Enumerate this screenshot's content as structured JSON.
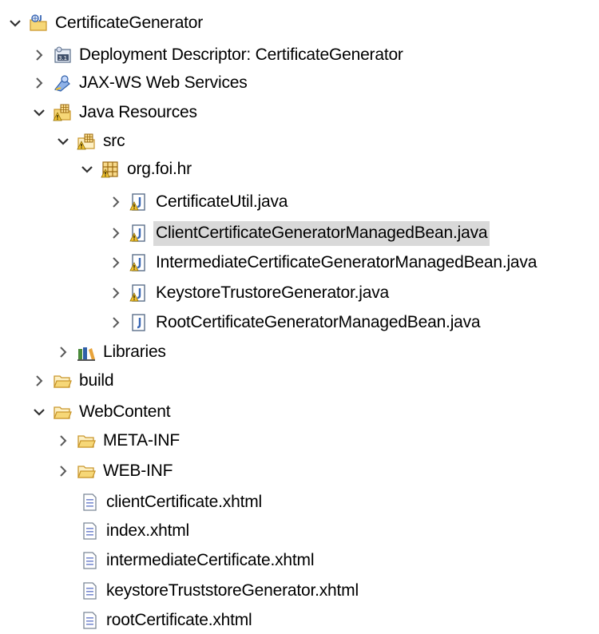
{
  "tree": {
    "project": {
      "label": "CertificateGenerator",
      "icon": "eclipse-web-project-icon"
    },
    "deployment": {
      "label": "Deployment Descriptor: CertificateGenerator",
      "icon": "deployment-descriptor-icon"
    },
    "jaxws": {
      "label": "JAX-WS Web Services",
      "icon": "web-services-icon"
    },
    "java_resources": {
      "label": "Java Resources",
      "icon": "java-resources-icon"
    },
    "src": {
      "label": "src",
      "icon": "source-folder-icon"
    },
    "package": {
      "label": "org.foi.hr",
      "icon": "java-package-icon"
    },
    "java_files": [
      {
        "label": "CertificateUtil.java",
        "warning": true
      },
      {
        "label": "ClientCertificateGeneratorManagedBean.java",
        "warning": true,
        "selected": true
      },
      {
        "label": "IntermediateCertificateGeneratorManagedBean.java",
        "warning": true
      },
      {
        "label": "KeystoreTrustoreGenerator.java",
        "warning": true
      },
      {
        "label": "RootCertificateGeneratorManagedBean.java",
        "warning": false
      }
    ],
    "libraries": {
      "label": "Libraries",
      "icon": "libraries-icon"
    },
    "build": {
      "label": "build",
      "icon": "folder-icon"
    },
    "webcontent": {
      "label": "WebContent",
      "icon": "folder-icon"
    },
    "meta_inf": {
      "label": "META-INF",
      "icon": "folder-icon"
    },
    "web_inf": {
      "label": "WEB-INF",
      "icon": "folder-icon"
    },
    "xhtml_files": [
      {
        "label": "clientCertificate.xhtml"
      },
      {
        "label": "index.xhtml"
      },
      {
        "label": "intermediateCertificate.xhtml"
      },
      {
        "label": "keystoreTruststoreGenerator.xhtml"
      },
      {
        "label": "rootCertificate.xhtml"
      }
    ]
  },
  "colors": {
    "selection": "#d9d9d9",
    "folder": "#e8b84a",
    "java": "#5b8fd8",
    "warning": "#f2c230"
  }
}
